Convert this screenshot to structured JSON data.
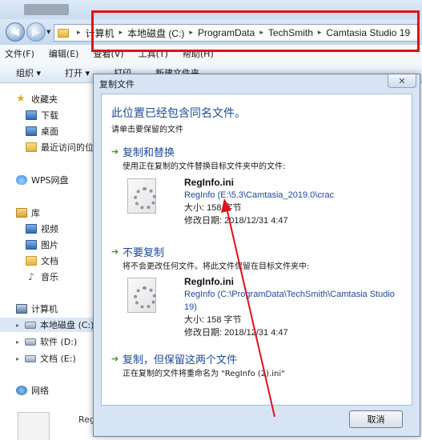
{
  "address_bar": {
    "crumbs": [
      "计算机",
      "本地磁盘 (C:)",
      "ProgramData",
      "TechSmith",
      "Camtasia Studio 19"
    ]
  },
  "menu": [
    "文件(F)",
    "编辑(E)",
    "查看(V)",
    "工具(T)",
    "帮助(H)"
  ],
  "toolbar": [
    "组织 ▾",
    "打开 ▾",
    "打印",
    "新建文件夹"
  ],
  "sidebar": {
    "favorites": {
      "label": "收藏夹",
      "items": [
        "下载",
        "桌面",
        "最近访问的位"
      ]
    },
    "wps": "WPS网盘",
    "libraries": {
      "label": "库",
      "items": [
        "视频",
        "图片",
        "文档",
        "音乐"
      ]
    },
    "computer": {
      "label": "计算机",
      "items": [
        "本地磁盘 (C:)",
        "软件 (D:)",
        "文档 (E:)"
      ]
    },
    "network": "网络"
  },
  "file_list": {
    "partial_label": "Reg"
  },
  "dialog": {
    "title": "复制文件",
    "close_label": "✕",
    "heading": "此位置已经包含同名文件。",
    "subheading": "请单击要保留的文件",
    "options": [
      {
        "title": "复制和替换",
        "description": "使用正在复制的文件替换目标文件夹中的文件:",
        "file_name": "RegInfo.ini",
        "path_lines": [
          "RegInfo (E:\\5.3\\Camtasia_2019.0\\crac"
        ],
        "size": "大小: 158 字节",
        "modified": "修改日期: 2018/12/31 4:47"
      },
      {
        "title": "不要复制",
        "description": "将不会更改任何文件。将此文件保留在目标文件夹中:",
        "file_name": "RegInfo.ini",
        "path_lines": [
          "RegInfo (C:\\ProgramData\\TechSmith\\Camtasia Studio",
          "19)"
        ],
        "size": "大小: 158 字节",
        "modified": "修改日期: 2018/12/31 4:47"
      },
      {
        "title": "复制，但保留这两个文件",
        "description": "正在复制的文件将重命名为 \"RegInfo (2).ini\""
      }
    ],
    "cancel_label": "取消"
  },
  "colors": {
    "highlight_box": "#e0101b",
    "annotation_arrow": "#e0101b",
    "dialog_link_blue": "#1c4a97"
  }
}
